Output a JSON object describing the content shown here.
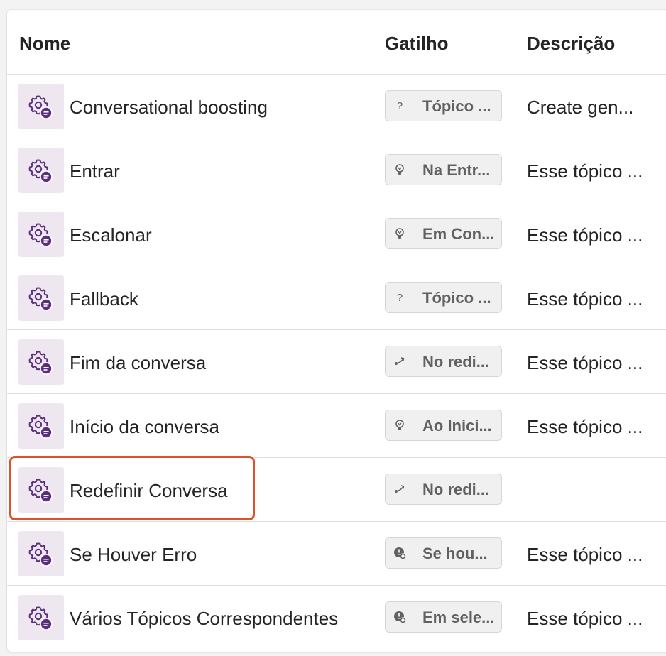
{
  "colors": {
    "accent_purple": "#5c2e7e",
    "icon_bg": "#eee7f0",
    "highlight": "#e0502a"
  },
  "table": {
    "columns": {
      "name": "Nome",
      "trigger": "Gatilho",
      "description": "Descrição"
    },
    "rows": [
      {
        "name": "Conversational boosting",
        "trigger_icon": "question-icon",
        "trigger": "Tópico ...",
        "description": "Create gen..."
      },
      {
        "name": "Entrar",
        "trigger_icon": "lightbulb-icon",
        "trigger": "Na Entr...",
        "description": "Esse tópico ..."
      },
      {
        "name": "Escalonar",
        "trigger_icon": "lightbulb-icon",
        "trigger": "Em Con...",
        "description": "Esse tópico ..."
      },
      {
        "name": "Fallback",
        "trigger_icon": "question-icon",
        "trigger": "Tópico ...",
        "description": "Esse tópico ..."
      },
      {
        "name": "Fim da conversa",
        "trigger_icon": "redirect-icon",
        "trigger": "No redi...",
        "description": "Esse tópico ..."
      },
      {
        "name": "Início da conversa",
        "trigger_icon": "lightbulb-icon",
        "trigger": "Ao Inici...",
        "description": "Esse tópico ..."
      },
      {
        "name": "Redefinir Conversa",
        "trigger_icon": "redirect-icon",
        "trigger": "No redi...",
        "description": ""
      },
      {
        "name": "Se Houver Erro",
        "trigger_icon": "error-gear-icon",
        "trigger": "Se hou...",
        "description": "Esse tópico ..."
      },
      {
        "name": "Vários Tópicos Correspondentes",
        "trigger_icon": "error-gear-icon",
        "trigger": "Em sele...",
        "description": "Esse tópico ..."
      }
    ]
  }
}
